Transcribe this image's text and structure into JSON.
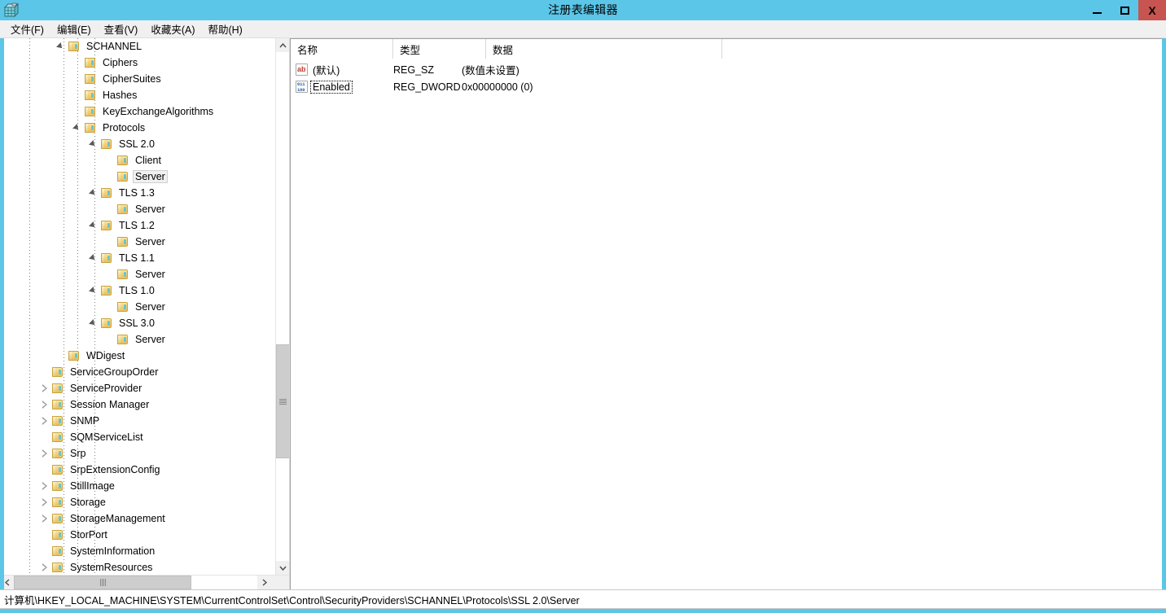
{
  "window": {
    "title": "注册表编辑器",
    "app_icon": "registry-editor-icon",
    "controls": {
      "minimize": "minimize-icon",
      "maximize": "maximize-icon",
      "close": "X"
    },
    "accent_color": "#5cc6e8",
    "close_color": "#c75450"
  },
  "menubar": {
    "items": [
      {
        "label": "文件(F)"
      },
      {
        "label": "编辑(E)"
      },
      {
        "label": "查看(V)"
      },
      {
        "label": "收藏夹(A)"
      },
      {
        "label": "帮助(H)"
      }
    ]
  },
  "tree": {
    "nodes": [
      {
        "label": "SCHANNEL",
        "indent": 3,
        "state": "expanded",
        "selected": false
      },
      {
        "label": "Ciphers",
        "indent": 4,
        "state": "leaf",
        "selected": false
      },
      {
        "label": "CipherSuites",
        "indent": 4,
        "state": "leaf",
        "selected": false
      },
      {
        "label": "Hashes",
        "indent": 4,
        "state": "leaf",
        "selected": false
      },
      {
        "label": "KeyExchangeAlgorithms",
        "indent": 4,
        "state": "leaf",
        "selected": false
      },
      {
        "label": "Protocols",
        "indent": 4,
        "state": "expanded",
        "selected": false
      },
      {
        "label": "SSL 2.0",
        "indent": 5,
        "state": "expanded",
        "selected": false
      },
      {
        "label": "Client",
        "indent": 6,
        "state": "leaf",
        "selected": false
      },
      {
        "label": "Server",
        "indent": 6,
        "state": "leaf",
        "selected": true
      },
      {
        "label": "TLS 1.3",
        "indent": 5,
        "state": "expanded",
        "selected": false
      },
      {
        "label": "Server",
        "indent": 6,
        "state": "leaf",
        "selected": false
      },
      {
        "label": "TLS 1.2",
        "indent": 5,
        "state": "expanded",
        "selected": false
      },
      {
        "label": "Server",
        "indent": 6,
        "state": "leaf",
        "selected": false
      },
      {
        "label": "TLS 1.1",
        "indent": 5,
        "state": "expanded",
        "selected": false
      },
      {
        "label": "Server",
        "indent": 6,
        "state": "leaf",
        "selected": false
      },
      {
        "label": "TLS 1.0",
        "indent": 5,
        "state": "expanded",
        "selected": false
      },
      {
        "label": "Server",
        "indent": 6,
        "state": "leaf",
        "selected": false
      },
      {
        "label": "SSL 3.0",
        "indent": 5,
        "state": "expanded",
        "selected": false
      },
      {
        "label": "Server",
        "indent": 6,
        "state": "leaf",
        "selected": false
      },
      {
        "label": "WDigest",
        "indent": 3,
        "state": "leaf",
        "selected": false
      },
      {
        "label": "ServiceGroupOrder",
        "indent": 2,
        "state": "leaf",
        "selected": false
      },
      {
        "label": "ServiceProvider",
        "indent": 2,
        "state": "collapsed",
        "selected": false
      },
      {
        "label": "Session Manager",
        "indent": 2,
        "state": "collapsed",
        "selected": false
      },
      {
        "label": "SNMP",
        "indent": 2,
        "state": "collapsed",
        "selected": false
      },
      {
        "label": "SQMServiceList",
        "indent": 2,
        "state": "leaf",
        "selected": false
      },
      {
        "label": "Srp",
        "indent": 2,
        "state": "collapsed",
        "selected": false
      },
      {
        "label": "SrpExtensionConfig",
        "indent": 2,
        "state": "leaf",
        "selected": false
      },
      {
        "label": "StillImage",
        "indent": 2,
        "state": "collapsed",
        "selected": false
      },
      {
        "label": "Storage",
        "indent": 2,
        "state": "collapsed",
        "selected": false
      },
      {
        "label": "StorageManagement",
        "indent": 2,
        "state": "collapsed",
        "selected": false
      },
      {
        "label": "StorPort",
        "indent": 2,
        "state": "leaf",
        "selected": false
      },
      {
        "label": "SystemInformation",
        "indent": 2,
        "state": "leaf",
        "selected": false
      },
      {
        "label": "SystemResources",
        "indent": 2,
        "state": "collapsed",
        "selected": false
      }
    ],
    "scrollbar": {
      "up_arrow": "⌃",
      "down_arrow": "⌄",
      "left_arrow": "‹",
      "right_arrow": "›"
    }
  },
  "list": {
    "columns": [
      {
        "label": "名称"
      },
      {
        "label": "类型"
      },
      {
        "label": "数据"
      }
    ],
    "rows": [
      {
        "icon": "string-value-icon",
        "name": "(默认)",
        "type": "REG_SZ",
        "data": "(数值未设置)",
        "focused": false
      },
      {
        "icon": "dword-value-icon",
        "name": "Enabled",
        "type": "REG_DWORD",
        "data": "0x00000000 (0)",
        "focused": true
      }
    ]
  },
  "statusbar": {
    "path": "计算机\\HKEY_LOCAL_MACHINE\\SYSTEM\\CurrentControlSet\\Control\\SecurityProviders\\SCHANNEL\\Protocols\\SSL 2.0\\Server"
  }
}
